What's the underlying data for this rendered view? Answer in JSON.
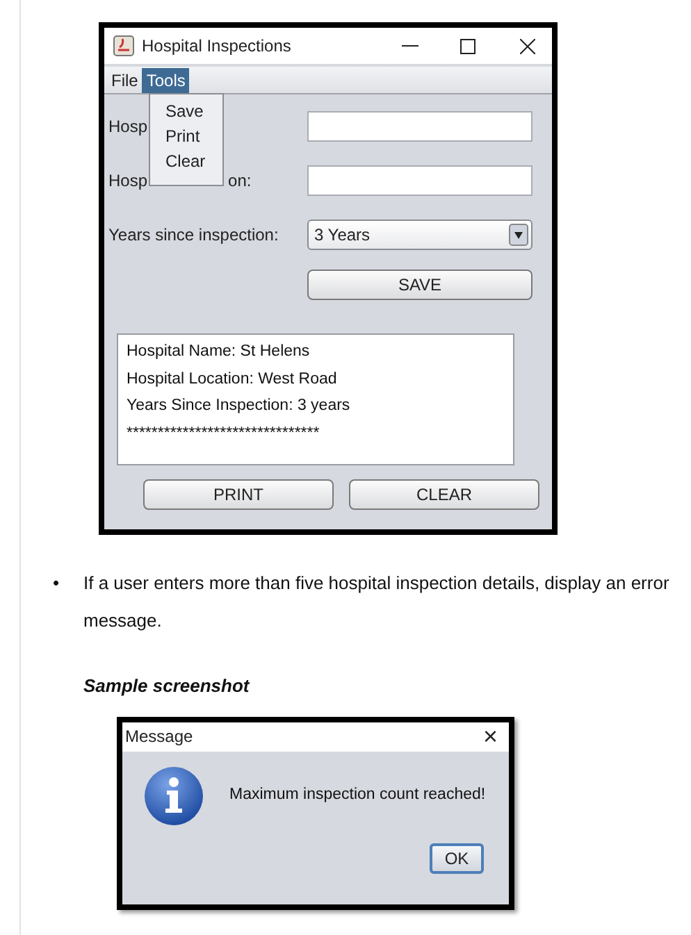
{
  "app_window": {
    "title": "Hospital Inspections",
    "menus": [
      {
        "label": "File",
        "selected": false
      },
      {
        "label": "Tools",
        "selected": true
      }
    ],
    "open_menu": {
      "items": [
        "Save",
        "Print",
        "Clear"
      ]
    },
    "fields": [
      {
        "label_parts": [
          "Hosp"
        ]
      },
      {
        "label_parts": [
          "Hosp",
          "on:"
        ]
      }
    ],
    "combo": {
      "label": "Years since inspection:",
      "value": "3 Years"
    },
    "save_button": "SAVE",
    "output_lines": [
      "Hospital Name: St Helens",
      "Hospital Location: West Road",
      "Years Since Inspection: 3 years",
      "*******************************"
    ],
    "buttons": [
      "PRINT",
      "CLEAR"
    ]
  },
  "bullet": {
    "marker": "•",
    "text": "If a user enters more than five hospital inspection details, display an error message."
  },
  "caption": "Sample screenshot",
  "dialog": {
    "title": "Message",
    "close": "×",
    "message": "Maximum inspection count reached!",
    "button": "OK"
  }
}
